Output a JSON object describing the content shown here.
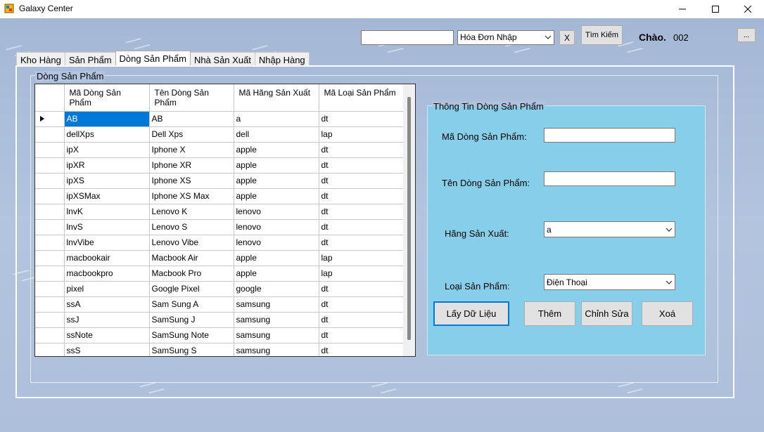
{
  "window": {
    "title": "Galaxy Center",
    "icon": "app-icon",
    "controls": {
      "minimize": "—",
      "maximize": "☐",
      "close": "✕"
    }
  },
  "toolbar": {
    "search_value": "",
    "type_select": "Hóa Đơn Nhập",
    "clear_label": "X",
    "search_label": "Tìm Kiếm",
    "greeting": "Chào.",
    "user": "002",
    "logout_label": "..."
  },
  "tabs": [
    {
      "label": "Kho Hàng",
      "active": false
    },
    {
      "label": "Sản Phẩm",
      "active": false
    },
    {
      "label": "Dòng Sản Phẩm",
      "active": true
    },
    {
      "label": "Nhà Sản Xuất",
      "active": false
    },
    {
      "label": "Nhập Hàng",
      "active": false
    }
  ],
  "list_group": {
    "title": "Dòng Sản Phẩm",
    "columns": [
      "Mã Dòng Sản Phẩm",
      "Tên Dòng Sản Phẩm",
      "Mã Hãng Sản Xuất",
      "Mã Loại Sản Phẩm"
    ],
    "rows": [
      [
        "AB",
        "AB",
        "a",
        "dt"
      ],
      [
        "dellXps",
        "Dell Xps",
        "dell",
        "lap"
      ],
      [
        "ipX",
        "Iphone X",
        "apple",
        "dt"
      ],
      [
        "ipXR",
        "Iphone XR",
        "apple",
        "dt"
      ],
      [
        "ipXS",
        "Iphone XS",
        "apple",
        "dt"
      ],
      [
        "ipXSMax",
        "Iphone XS Max",
        "apple",
        "dt"
      ],
      [
        "lnvK",
        "Lenovo K",
        "lenovo",
        "dt"
      ],
      [
        "lnvS",
        "Lenovo S",
        "lenovo",
        "dt"
      ],
      [
        "lnvVibe",
        "Lenovo Vibe",
        "lenovo",
        "dt"
      ],
      [
        "macbookair",
        "Macbook Air",
        "apple",
        "lap"
      ],
      [
        "macbookpro",
        "Macbook Pro",
        "apple",
        "lap"
      ],
      [
        "pixel",
        "Google Pixel",
        "google",
        "dt"
      ],
      [
        "ssA",
        "Sam Sung A",
        "samsung",
        "dt"
      ],
      [
        "ssJ",
        "SamSung J",
        "samsung",
        "dt"
      ],
      [
        "ssNote",
        "SamSung Note",
        "samsung",
        "dt"
      ],
      [
        "ssS",
        "SamSung S",
        "samsung",
        "dt"
      ]
    ]
  },
  "info_group": {
    "title": "Thông Tin Dòng Sản Phẩm",
    "ma_label": "Mã Dòng Sản Phẩm:",
    "ma_value": "",
    "ten_label": "Tên Dòng Sản Phẩm:",
    "ten_value": "",
    "hang_label": "Hãng Sản Xuất:",
    "hang_value": "a",
    "loai_label": "Loại Sản Phẩm:",
    "loai_value": "Điện Thoại",
    "btn_load": "Lấy Dữ Liệu",
    "btn_add": "Thêm",
    "btn_edit": "Chỉnh Sửa",
    "btn_delete": "Xoá"
  },
  "colors": {
    "selection": "#0078d7",
    "info_panel": "#87ceeb",
    "background": "#b2c4de"
  }
}
